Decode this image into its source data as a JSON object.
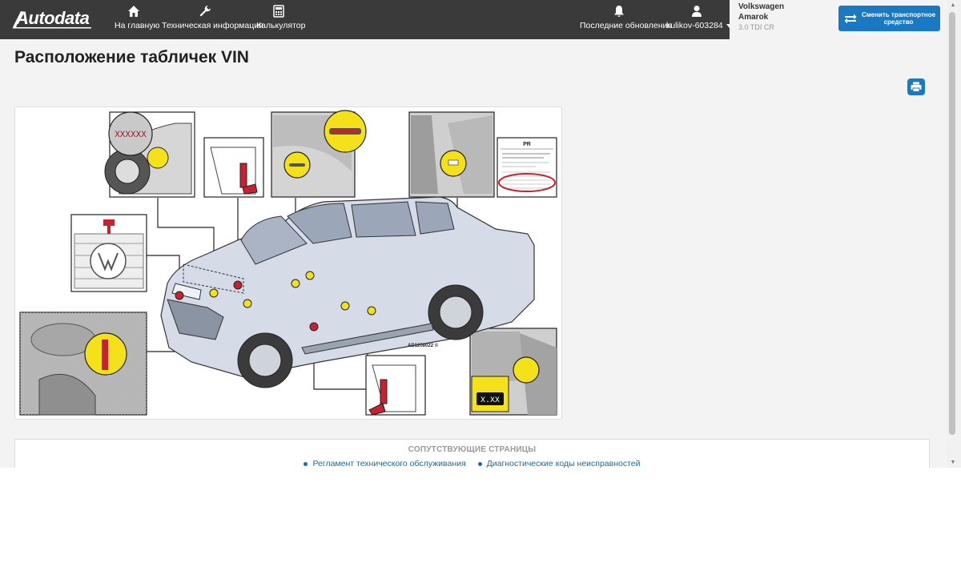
{
  "header": {
    "logo_text": "Autodata",
    "nav": {
      "home": "На главную",
      "tech": "Техническая информация",
      "calc": "Калькулятор",
      "updates": "Последние обновления",
      "user": "kulikov-603284"
    },
    "vehicle": {
      "make": "Volkswagen",
      "model": "Amarok",
      "engine": "3.0 TDI CR"
    },
    "change_vehicle_button": "Сменить транспортное средство"
  },
  "page": {
    "title": "Расположение табличек VIN"
  },
  "diagram": {
    "reference": "AD1208022 ©",
    "label_pr": "PR",
    "label_vin_mask": "XXXXXX",
    "label_vin_short": "X.XX"
  },
  "related": {
    "title": "СОПУТСТВУЮЩИЕ СТРАНИЦЫ",
    "links": [
      "Регламент технического обслуживания",
      "Диагностические коды неисправностей"
    ]
  },
  "colors": {
    "header_bg": "#3a3a3a",
    "accent": "#1979c3",
    "marker_yellow": "#f5e11a",
    "marker_red": "#c8212f"
  }
}
